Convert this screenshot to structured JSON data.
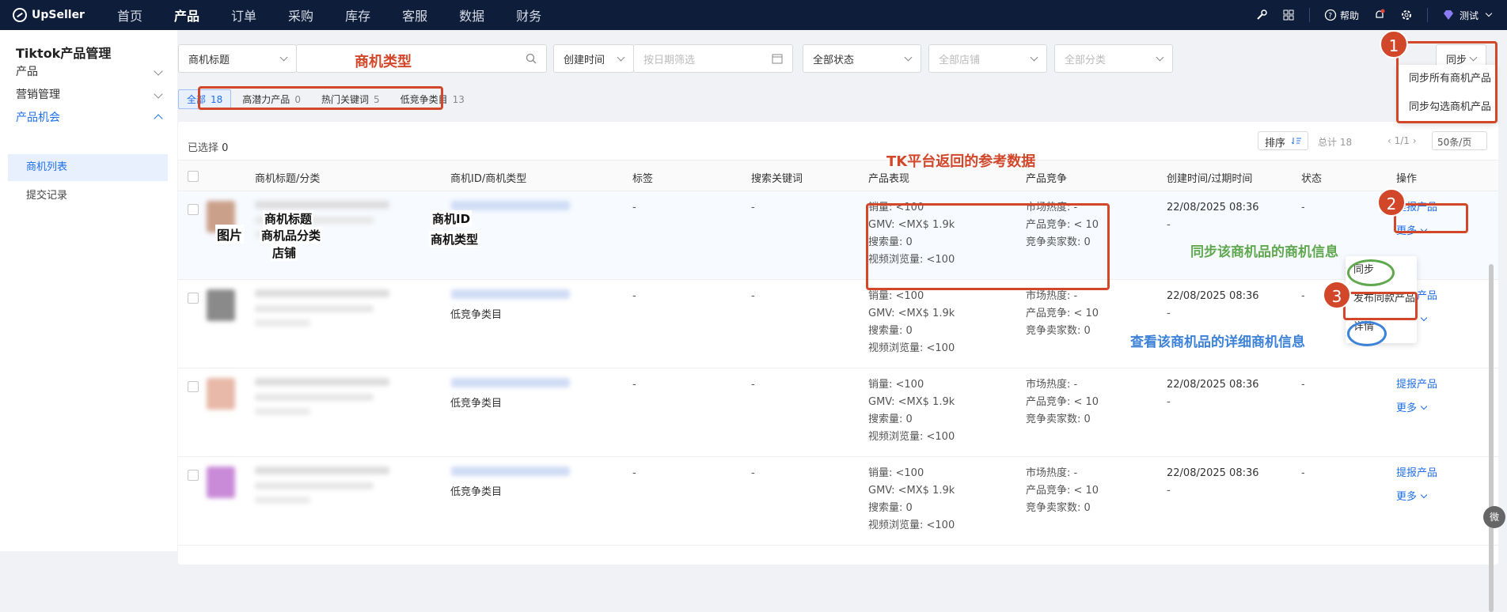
{
  "app": {
    "logo_text": "UpSeller"
  },
  "nav": {
    "items": [
      "首页",
      "产品",
      "订单",
      "采购",
      "库存",
      "客服",
      "数据",
      "财务"
    ],
    "active": "产品",
    "help": "帮助",
    "user": "测试"
  },
  "sidebar": {
    "title": "Tiktok产品管理",
    "groups": [
      {
        "label": "产品"
      },
      {
        "label": "营销管理"
      },
      {
        "label": "产品机会"
      }
    ],
    "sub": [
      "商机列表",
      "提交记录"
    ]
  },
  "filters": {
    "title_select": "商机标题",
    "create_time": "创建时间",
    "date_placeholder": "按日期筛选",
    "status": "全部状态",
    "shops": "全部店铺",
    "category": "全部分类",
    "sync": "同步"
  },
  "tabs": [
    {
      "label": "全部",
      "count": "18"
    },
    {
      "label": "高潜力产品",
      "count": "0"
    },
    {
      "label": "热门关键词",
      "count": "5"
    },
    {
      "label": "低竞争类目",
      "count": "13"
    }
  ],
  "toolbar": {
    "selected_label": "已选择",
    "selected_count": "0",
    "sort": "排序",
    "total": "总计 18",
    "pager": "1/1",
    "per_page": "50条/页"
  },
  "table": {
    "headers": [
      "商机标题/分类",
      "商机ID/商机类型",
      "标签",
      "搜索关键词",
      "产品表现",
      "产品竞争",
      "创建时间/过期时间",
      "状态",
      "操作"
    ],
    "rows": [
      {
        "type": "",
        "tag": "-",
        "keyword": "-",
        "perf": [
          "销量: <100",
          "GMV: <MX$ 1.9k",
          "搜索量: 0",
          "视频浏览量: <100"
        ],
        "comp": [
          "市场热度: -",
          "产品竞争: < 10",
          "竞争卖家数: 0"
        ],
        "created": "22/08/2025 08:36",
        "expires": "-",
        "status": "-",
        "action": "提报产品",
        "more": "更多"
      },
      {
        "type": "低竞争类目",
        "tag": "-",
        "keyword": "-",
        "perf": [
          "销量: <100",
          "GMV: <MX$ 1.9k",
          "搜索量: 0",
          "视频浏览量: <100"
        ],
        "comp": [
          "市场热度: -",
          "产品竞争: < 10",
          "竞争卖家数: 0"
        ],
        "created": "22/08/2025 08:36",
        "expires": "-",
        "status": "-",
        "action": "提报产品",
        "more": "更多"
      },
      {
        "type": "低竞争类目",
        "tag": "-",
        "keyword": "-",
        "perf": [
          "销量: <100",
          "GMV: <MX$ 1.9k",
          "搜索量: 0",
          "视频浏览量: <100"
        ],
        "comp": [
          "市场热度: -",
          "产品竞争: < 10",
          "竞争卖家数: 0"
        ],
        "created": "22/08/2025 08:36",
        "expires": "-",
        "status": "-",
        "action": "提报产品",
        "more": "更多"
      },
      {
        "type": "低竞争类目",
        "tag": "-",
        "keyword": "-",
        "perf": [
          "销量: <100",
          "GMV: <MX$ 1.9k",
          "搜索量: 0",
          "视频浏览量: <100"
        ],
        "comp": [
          "市场热度: -",
          "产品竞争: < 10",
          "竞争卖家数: 0"
        ],
        "created": "22/08/2025 08:36",
        "expires": "-",
        "status": "-",
        "action": "提报产品",
        "more": "更多"
      }
    ]
  },
  "sync_menu": [
    "同步所有商机产品",
    "同步勾选商机产品"
  ],
  "more_menu": [
    "同步",
    "发布同款产品",
    "详情"
  ],
  "annotations": {
    "opp_type": "商机类型",
    "tk_data": "TK平台返回的参考数据",
    "sync_info": "同步该商机品的商机信息",
    "detail_info": "查看该商机品的详细商机信息",
    "image": "图片",
    "title": "商机标题",
    "category": "商机品分类",
    "shop": "店铺",
    "opp_id": "商机ID",
    "opp_kind": "商机类型",
    "badges": [
      "1",
      "2",
      "3"
    ]
  },
  "float_icon": "微"
}
